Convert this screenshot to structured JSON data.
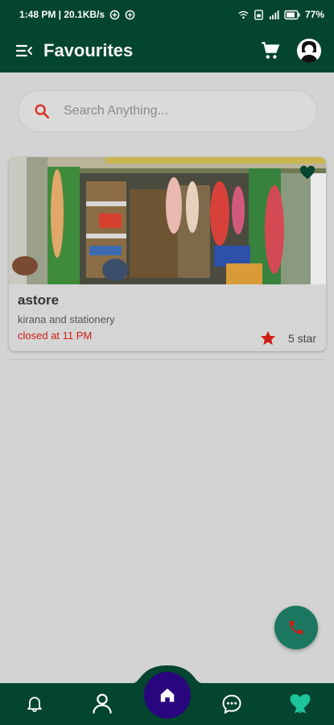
{
  "status_bar": {
    "time_speed": "1:48 PM | 20.1KB/s",
    "battery": "77%"
  },
  "header": {
    "title": "Favourites",
    "menu_icon": "menu-collapse-icon",
    "cart_icon": "cart-icon",
    "avatar_icon": "user-avatar"
  },
  "search": {
    "placeholder": "Search Anything...",
    "value": ""
  },
  "favourites": [
    {
      "name": "astore",
      "category": "kirana and stationery",
      "status": "closed at 11 PM",
      "rating_label": "5 star",
      "image_icon": "shop-photo"
    }
  ],
  "fab": {
    "icon": "phone-icon"
  },
  "bottom_nav": {
    "items": [
      {
        "icon": "bell-icon"
      },
      {
        "icon": "person-icon"
      },
      {
        "icon": "home-icon"
      },
      {
        "icon": "chat-icon"
      },
      {
        "icon": "heart-icon"
      }
    ]
  },
  "colors": {
    "primary": "#04452f",
    "accent_red": "#d01c12",
    "fab": "#1b7760",
    "home_button": "#2a067e",
    "heart_active": "#1cc49a"
  }
}
